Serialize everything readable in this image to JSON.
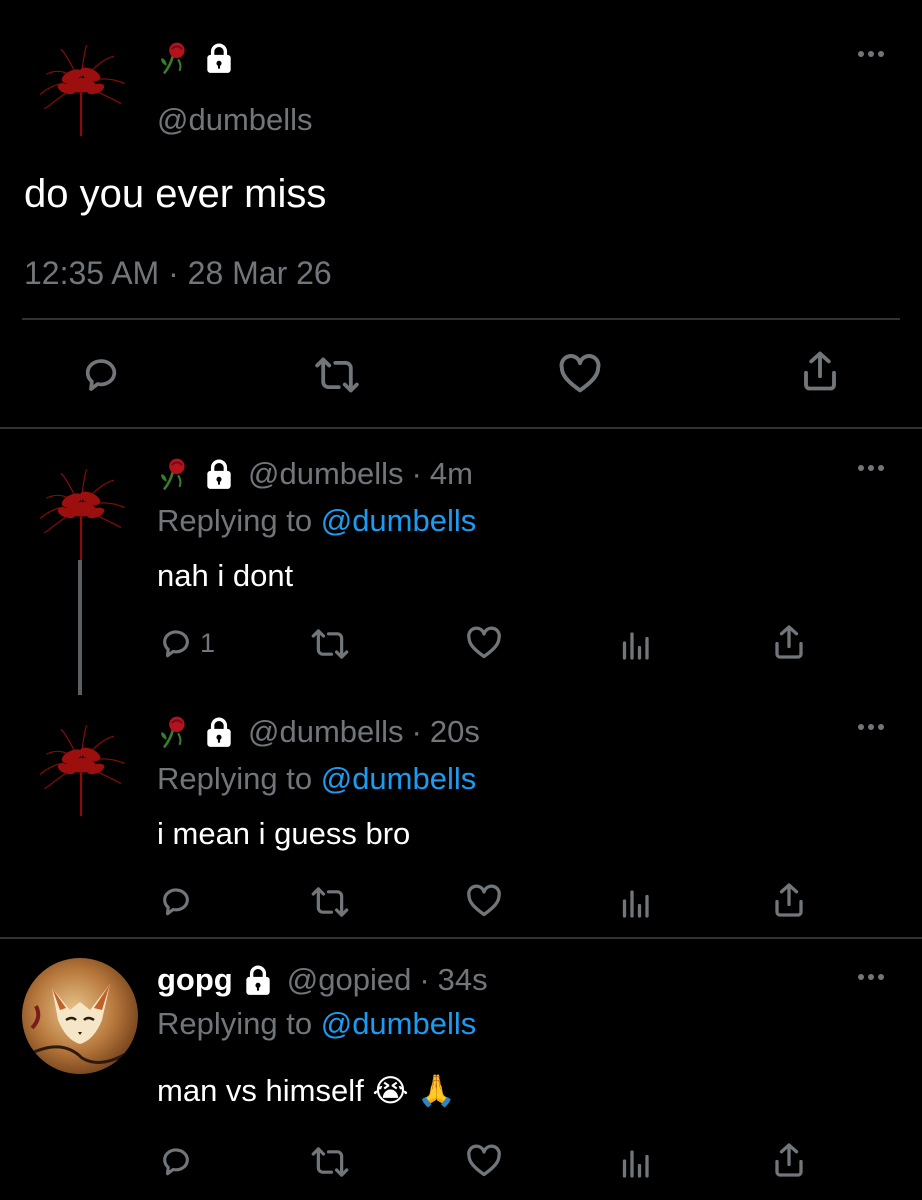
{
  "main_tweet": {
    "handle": "@dumbells",
    "text": "do you ever miss",
    "timestamp": "12:35 AM · 28 Mar 26",
    "avatar_icon": "red-spider-lily-icon",
    "name_icons": [
      "rose-icon",
      "lock-icon"
    ],
    "actions": [
      "reply-icon",
      "retweet-icon",
      "like-icon",
      "share-icon"
    ]
  },
  "replies": [
    {
      "handle": "@dumbells",
      "time": "4m",
      "replying_label": "Replying to",
      "replying_handle": "@dumbells",
      "text": "nah i dont",
      "reply_count": "1"
    },
    {
      "handle": "@dumbells",
      "time": "20s",
      "replying_label": "Replying to",
      "replying_handle": "@dumbells",
      "text": "i mean i guess bro",
      "reply_count": ""
    },
    {
      "name": "gopg",
      "handle": "@gopied",
      "time": "34s",
      "replying_label": "Replying to",
      "replying_handle": "@dumbells",
      "text": "man vs himself 😭 🙏",
      "reply_count": ""
    }
  ],
  "separator": "·",
  "colors": {
    "background": "#000000",
    "text": "#e7e9ea",
    "muted": "#71767b",
    "link": "#1d9bf0",
    "divider": "#2f3336"
  }
}
